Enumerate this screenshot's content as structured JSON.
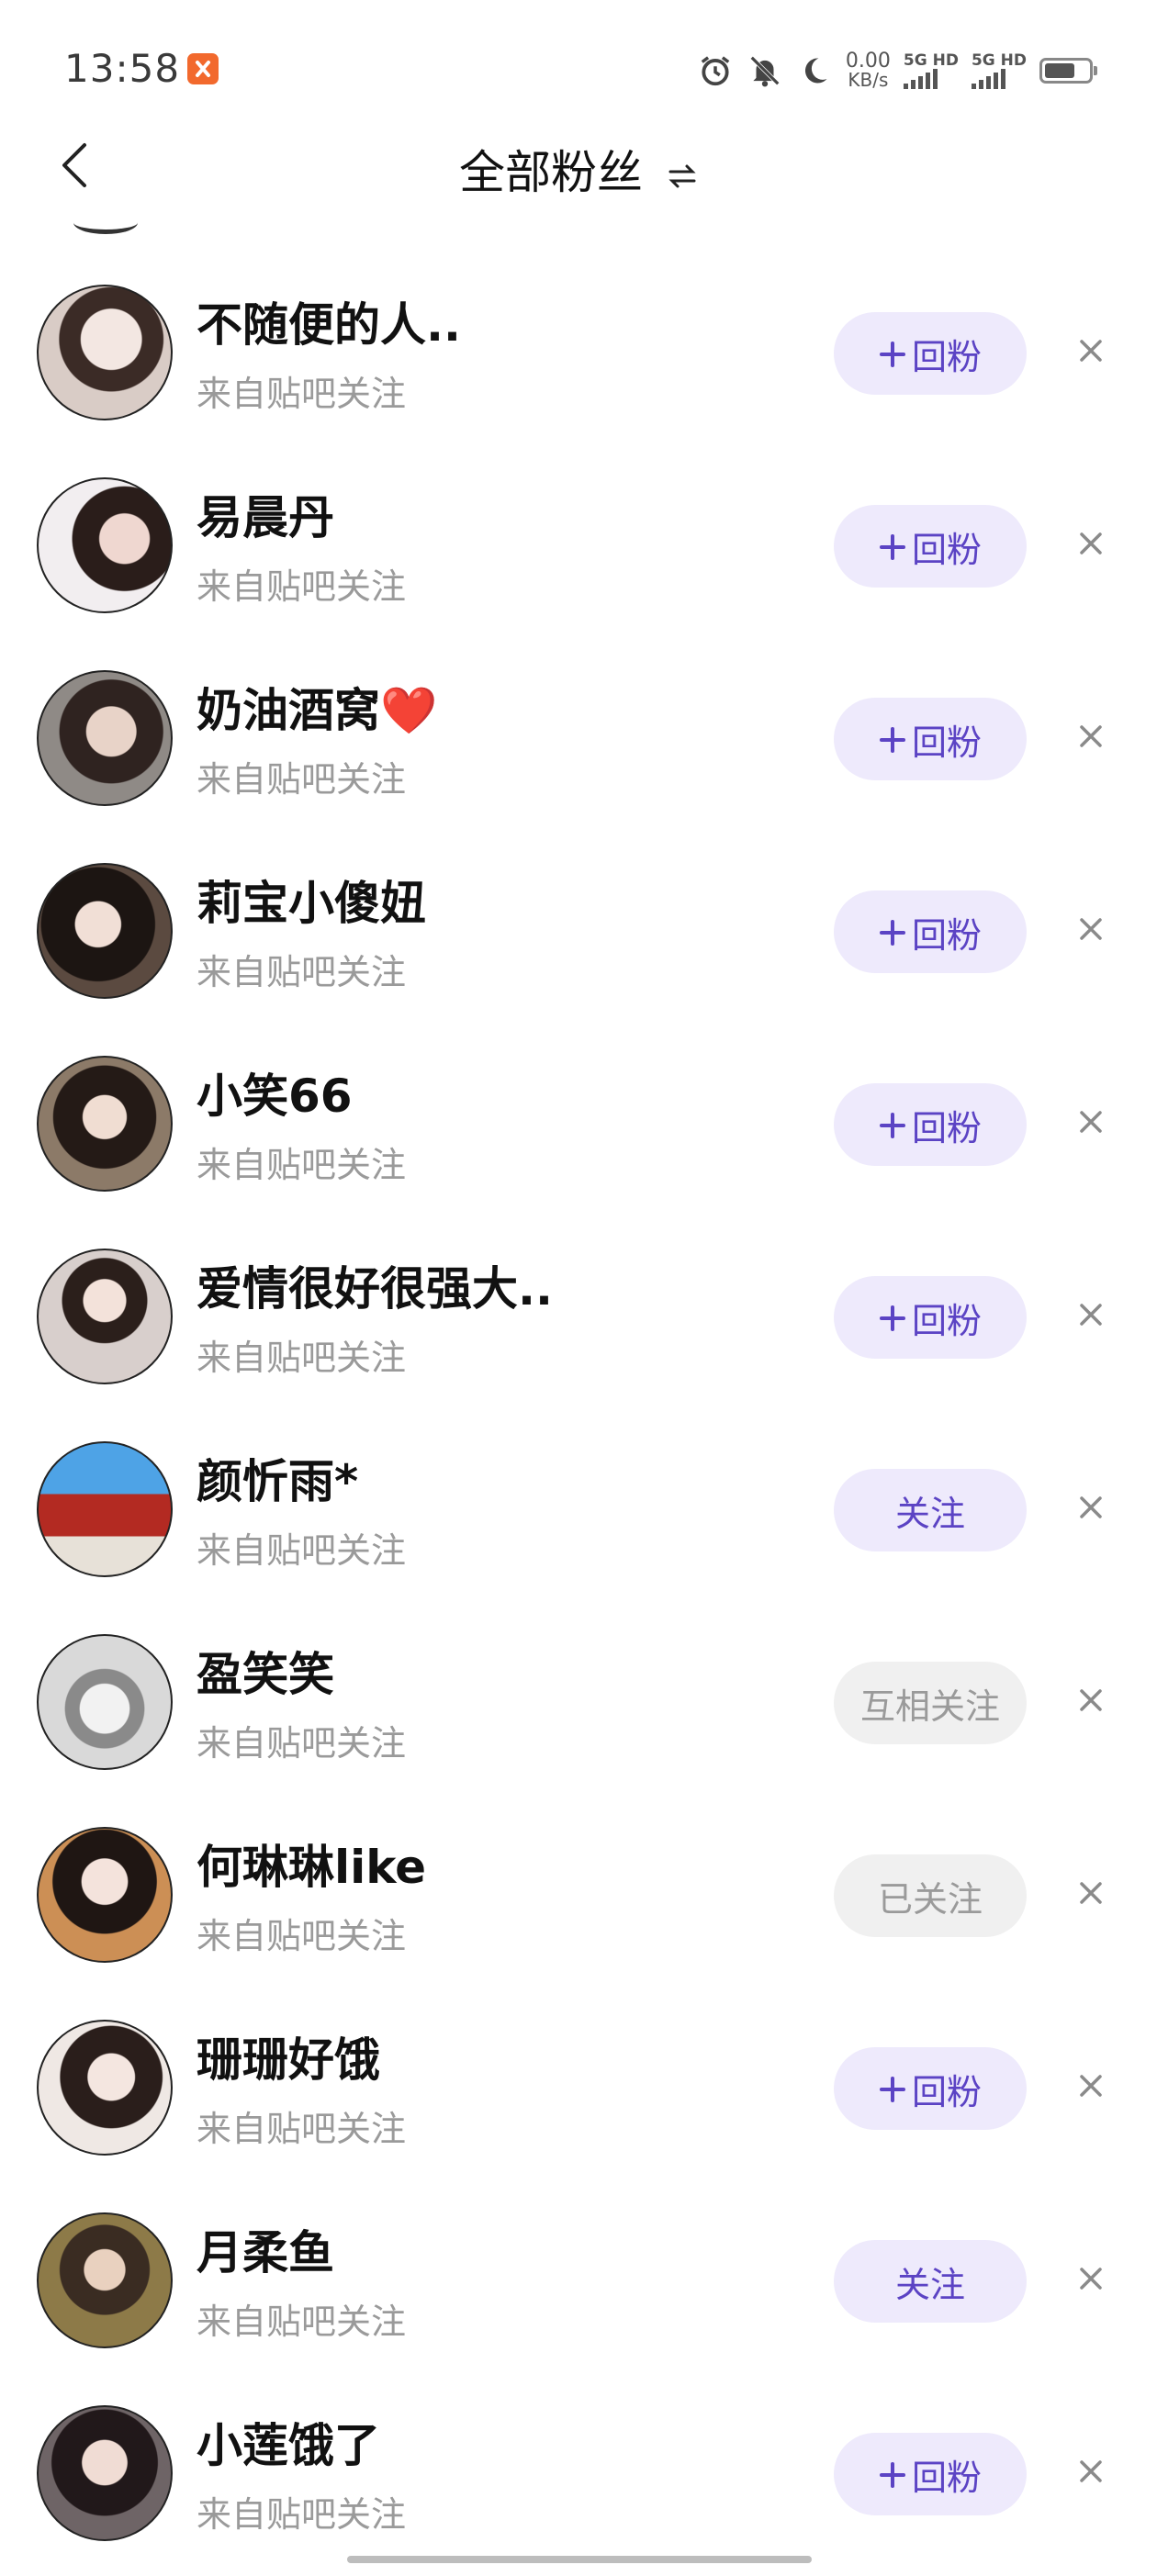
{
  "status_bar": {
    "time": "13:58",
    "net_speed_value": "0.00",
    "net_speed_unit": "KB/s",
    "signal_1_label": "5G HD",
    "signal_2_label": "5G HD",
    "battery_level": 0.7,
    "icons": [
      "alarm-icon",
      "mute-bell-icon",
      "moon-icon"
    ]
  },
  "header": {
    "back_icon": "chevron-left-icon",
    "title": "全部粉丝",
    "switch_icon": "swap-arrows-icon"
  },
  "colors": {
    "accent": "#5b43c4",
    "accent_bg": "#eeeafc",
    "muted": "#9a9a9a"
  },
  "fans": [
    {
      "name": "不随便的人..",
      "source": "来自贴吧关注",
      "action": "回粉",
      "style": "follow-back"
    },
    {
      "name": "易晨丹",
      "source": "来自贴吧关注",
      "action": "回粉",
      "style": "follow-back"
    },
    {
      "name": "奶油酒窝❤️",
      "source": "来自贴吧关注",
      "action": "回粉",
      "style": "follow-back"
    },
    {
      "name": "莉宝小傻妞",
      "source": "来自贴吧关注",
      "action": "回粉",
      "style": "follow-back"
    },
    {
      "name": "小笑66",
      "source": "来自贴吧关注",
      "action": "回粉",
      "style": "follow-back"
    },
    {
      "name": "爱情很好很强大..",
      "source": "来自贴吧关注",
      "action": "回粉",
      "style": "follow-back"
    },
    {
      "name": "颜忻雨*",
      "source": "来自贴吧关注",
      "action": "关注",
      "style": "follow"
    },
    {
      "name": "盈笑笑",
      "source": "来自贴吧关注",
      "action": "互相关注",
      "style": "mutual"
    },
    {
      "name": "何琳琳like",
      "source": "来自贴吧关注",
      "action": "已关注",
      "style": "followed"
    },
    {
      "name": "珊珊好饿",
      "source": "来自贴吧关注",
      "action": "回粉",
      "style": "follow-back"
    },
    {
      "name": "月柔鱼",
      "source": "来自贴吧关注",
      "action": "关注",
      "style": "follow"
    },
    {
      "name": "小莲饿了",
      "source": "来自贴吧关注",
      "action": "回粉",
      "style": "follow-back"
    }
  ]
}
